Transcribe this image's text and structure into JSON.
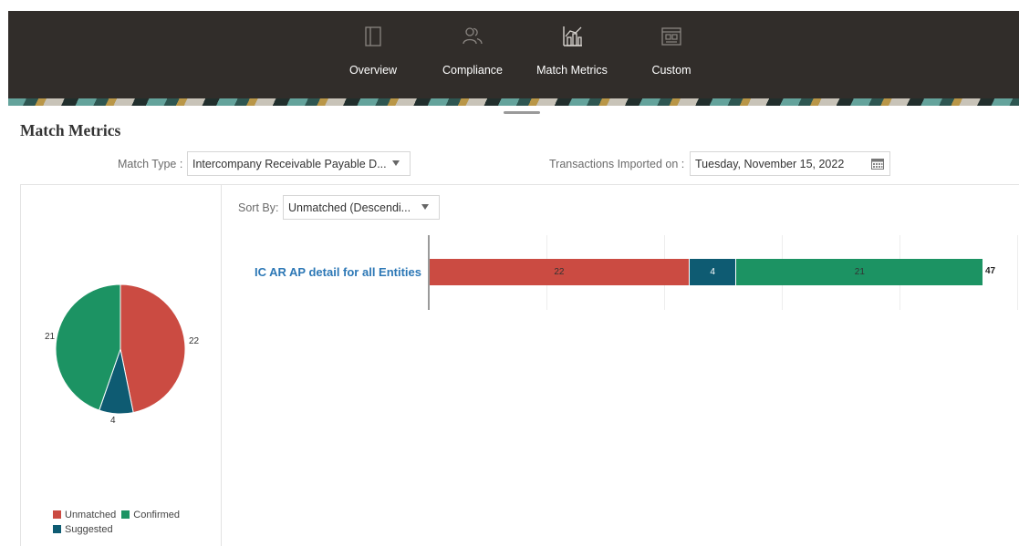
{
  "nav": {
    "items": [
      {
        "label": "Overview",
        "icon": "panel-icon"
      },
      {
        "label": "Compliance",
        "icon": "users-icon"
      },
      {
        "label": "Match Metrics",
        "icon": "bar-chart-icon"
      },
      {
        "label": "Custom",
        "icon": "dashboard-icon"
      }
    ]
  },
  "page": {
    "title": "Match Metrics"
  },
  "filters": {
    "match_type_label": "Match Type :",
    "match_type_value": "Intercompany Receivable Payable D...",
    "imported_label": "Transactions Imported on :",
    "imported_value": "Tuesday, November 15, 2022"
  },
  "sort": {
    "label": "Sort By:",
    "value": "Unmatched (Descendi..."
  },
  "colors": {
    "unmatched": "#cb4b42",
    "suggested": "#0e5b72",
    "confirmed": "#1c9363"
  },
  "pie": {
    "slices": [
      {
        "label": "Unmatched",
        "value": 22
      },
      {
        "label": "Suggested",
        "value": 4
      },
      {
        "label": "Confirmed",
        "value": 21
      }
    ],
    "value_labels": {
      "unmatched": "22",
      "suggested": "4",
      "confirmed": "21"
    }
  },
  "legend": {
    "unmatched": "Unmatched",
    "confirmed": "Confirmed",
    "suggested": "Suggested"
  },
  "bar": {
    "entity": "IC AR AP detail for all Entities",
    "unmatched": "22",
    "suggested": "4",
    "confirmed": "21",
    "total": "47"
  },
  "chart_data": [
    {
      "type": "pie",
      "categories": [
        "Unmatched",
        "Suggested",
        "Confirmed"
      ],
      "values": [
        22,
        4,
        21
      ],
      "legend": "bottom-left"
    },
    {
      "type": "bar",
      "orientation": "horizontal-stacked",
      "categories": [
        "IC AR AP detail for all Entities"
      ],
      "series": [
        {
          "name": "Unmatched",
          "values": [
            22
          ]
        },
        {
          "name": "Suggested",
          "values": [
            4
          ]
        },
        {
          "name": "Confirmed",
          "values": [
            21
          ]
        }
      ],
      "totals": [
        47
      ],
      "grid": true
    }
  ]
}
